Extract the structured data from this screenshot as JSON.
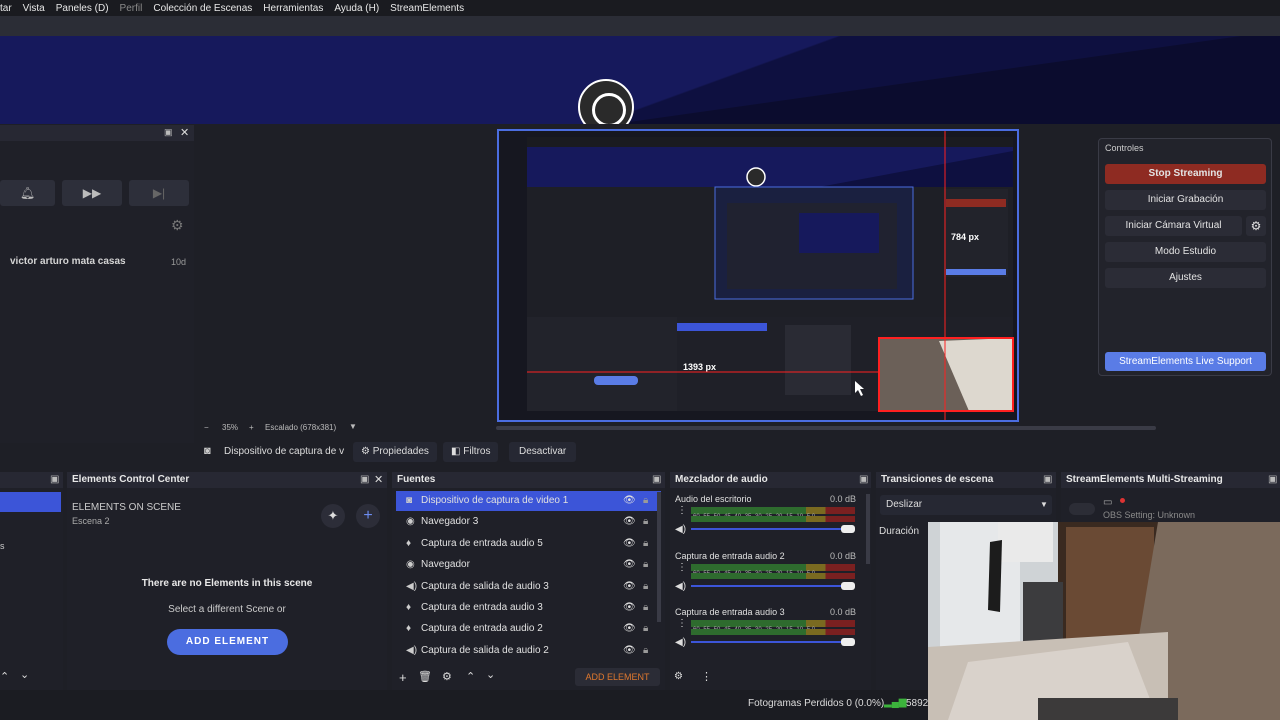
{
  "menu": [
    "tar",
    "Vista",
    "Paneles (D)",
    "Perfil",
    "Colección de Escenas",
    "Herramientas",
    "Ayuda (H)",
    "StreamElements"
  ],
  "chat": {
    "user": "victor arturo mata casas",
    "time": "10d"
  },
  "preview": {
    "zoom": "35%",
    "scale": "Escalado (678x381)",
    "px_a": "784 px",
    "px_b": "1393 px"
  },
  "source_toolbar": {
    "device": "Dispositivo de captura de v",
    "properties": "Propiedades",
    "filters": "Filtros",
    "deactivate": "Desactivar"
  },
  "controls": {
    "title": "Controles",
    "stop_streaming": "Stop Streaming",
    "start_recording": "Iniciar Grabación",
    "virtual_camera": "Iniciar Cámara Virtual",
    "studio_mode": "Modo Estudio",
    "settings": "Ajustes",
    "support": "StreamElements Live Support"
  },
  "ecc": {
    "title": "Elements Control Center",
    "on_scene": "ELEMENTS ON SCENE",
    "scene": "Escena 2",
    "no_elements": "There are no Elements in this scene",
    "select": "Select a different Scene or",
    "add": "ADD ELEMENT"
  },
  "sources": {
    "title": "Fuentes",
    "items": [
      {
        "name": "Dispositivo de captura de video 1",
        "icon": "camera-icon"
      },
      {
        "name": "Navegador 3",
        "icon": "globe-icon"
      },
      {
        "name": "Captura de entrada audio 5",
        "icon": "microphone-icon"
      },
      {
        "name": "Navegador",
        "icon": "globe-icon"
      },
      {
        "name": "Captura de salida de audio 3",
        "icon": "speaker-icon"
      },
      {
        "name": "Captura de entrada audio 3",
        "icon": "microphone-icon"
      },
      {
        "name": "Captura de entrada audio 2",
        "icon": "microphone-icon"
      },
      {
        "name": "Captura de salida de audio 2",
        "icon": "speaker-icon"
      }
    ],
    "add_element": "ADD ELEMENT"
  },
  "mixer": {
    "title": "Mezclador de audio",
    "channels": [
      {
        "name": "Audio del escritorio",
        "db": "0.0 dB"
      },
      {
        "name": "Captura de entrada audio 2",
        "db": "0.0 dB"
      },
      {
        "name": "Captura de entrada audio 3",
        "db": "0.0 dB"
      }
    ],
    "scale": "-60 -55 -50 -45 -40 -35 -30 -25 -20 -15 -10 -5 0"
  },
  "transitions": {
    "title": "Transiciones de escena",
    "value": "Deslizar",
    "duration": "Duración"
  },
  "multistream": {
    "title": "StreamElements Multi-Streaming",
    "obs_setting": "OBS Setting: Unknown"
  },
  "status": {
    "dropped": "Fotogramas Perdidos 0 (0.0%)",
    "bitrate": "5892"
  }
}
